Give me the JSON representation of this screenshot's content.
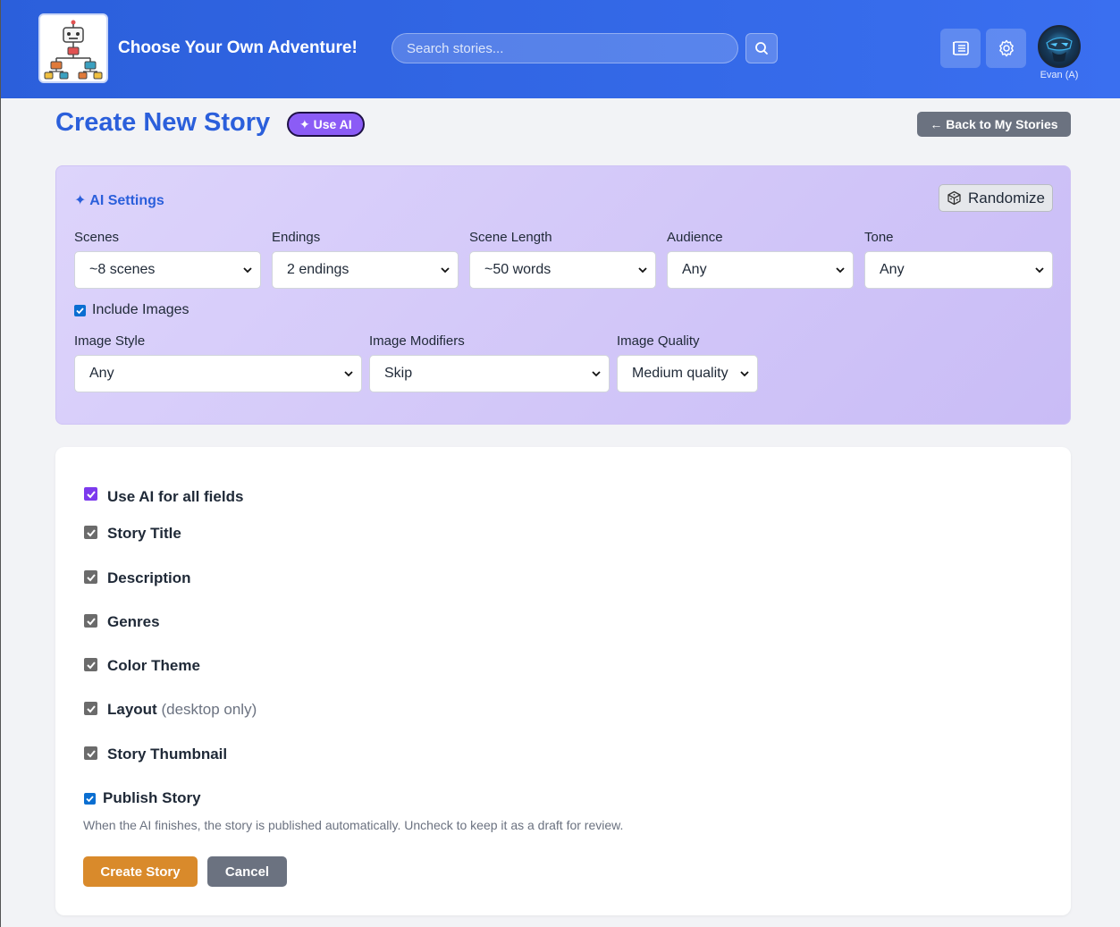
{
  "header": {
    "app_title": "Choose Your Own Adventure!",
    "search_placeholder": "Search stories...",
    "user_name": "Evan (A)"
  },
  "page": {
    "title": "Create New Story",
    "use_ai_label": "✦ Use AI",
    "back_label": "← Back to My Stories"
  },
  "ai_settings": {
    "title": "✦ AI Settings",
    "randomize_label": "Randomize",
    "fields_row1": [
      {
        "label": "Scenes",
        "value": "~8 scenes"
      },
      {
        "label": "Endings",
        "value": "2 endings"
      },
      {
        "label": "Scene Length",
        "value": "~50 words"
      },
      {
        "label": "Audience",
        "value": "Any"
      },
      {
        "label": "Tone",
        "value": "Any"
      }
    ],
    "include_images_label": "Include Images",
    "fields_row2": [
      {
        "label": "Image Style",
        "value": "Any"
      },
      {
        "label": "Image Modifiers",
        "value": "Skip"
      },
      {
        "label": "Image Quality",
        "value": "Medium quality"
      }
    ]
  },
  "form": {
    "use_ai_all_label": "Use AI for all fields",
    "options": [
      {
        "label": "Story Title"
      },
      {
        "label": "Description"
      },
      {
        "label": "Genres"
      },
      {
        "label": "Color Theme"
      },
      {
        "label": "Layout",
        "note": "(desktop only)"
      },
      {
        "label": "Story Thumbnail"
      }
    ],
    "publish_label": "Publish Story",
    "help_text": "When the AI finishes, the story is published automatically. Uncheck to keep it as a draft for review.",
    "create_label": "Create Story",
    "cancel_label": "Cancel"
  },
  "colors": {
    "header_blue": "#2b5fdb",
    "ai_purple": "#8b5cf6",
    "create_orange": "#d98a2b",
    "cancel_gray": "#6b7280"
  }
}
